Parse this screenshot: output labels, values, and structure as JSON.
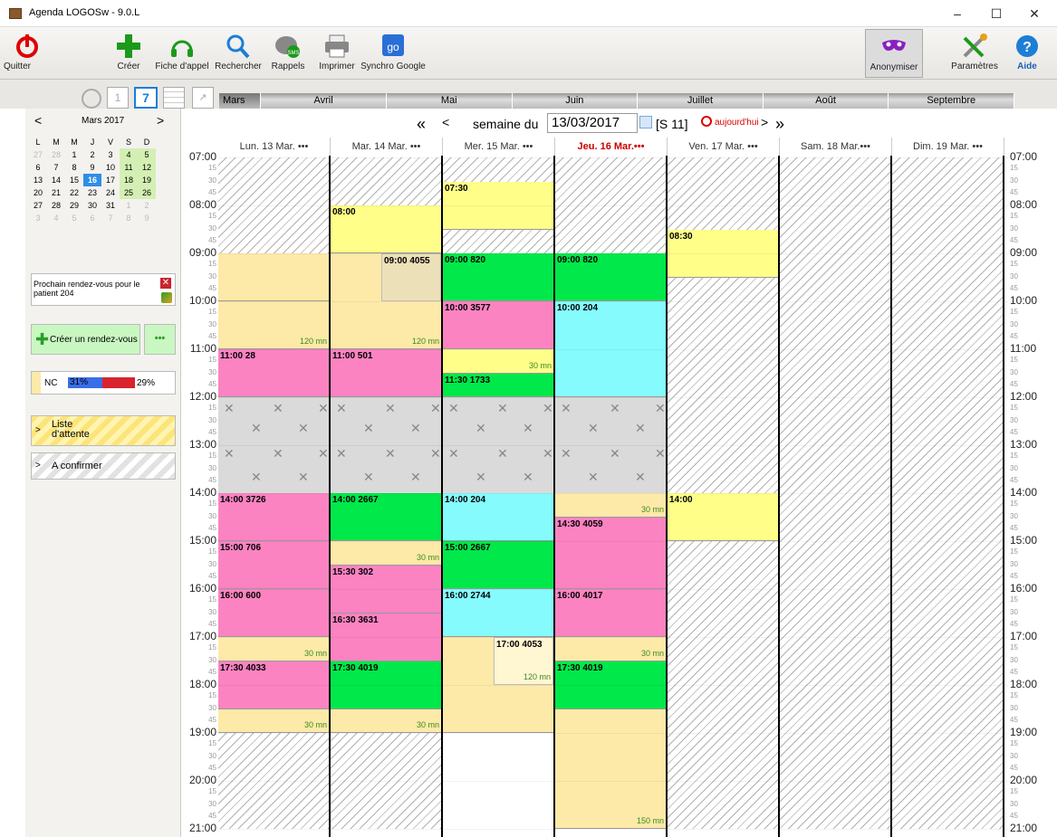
{
  "window": {
    "title": "Agenda LOGOSw - 9.0.L"
  },
  "toolbar": {
    "quit": "Quitter",
    "create": "Créer",
    "callsheet": "Fiche d'appel",
    "search": "Rechercher",
    "reminders": "Rappels",
    "print": "Imprimer",
    "gsync": "Synchro Google",
    "anonymize": "Anonymiser",
    "settings": "Paramètres",
    "help": "Aide",
    "sms_badge": "SMS",
    "calendar_day": "1",
    "calendar_week": "7"
  },
  "months": [
    "Mars",
    "Avril",
    "Mai",
    "Juin",
    "Juillet",
    "Août",
    "Septembre"
  ],
  "mini_calendar": {
    "title": "Mars 2017",
    "prev": "<",
    "next": ">",
    "weekdays": [
      "L",
      "M",
      "M",
      "J",
      "V",
      "S",
      "D"
    ],
    "weeks": [
      [
        "27",
        "28",
        "1",
        "2",
        "3",
        "4",
        "5"
      ],
      [
        "6",
        "7",
        "8",
        "9",
        "10",
        "11",
        "12"
      ],
      [
        "13",
        "14",
        "15",
        "16",
        "17",
        "18",
        "19"
      ],
      [
        "20",
        "21",
        "22",
        "23",
        "24",
        "25",
        "26"
      ],
      [
        "27",
        "28",
        "29",
        "30",
        "31",
        "1",
        "2"
      ],
      [
        "3",
        "4",
        "5",
        "6",
        "7",
        "8",
        "9"
      ]
    ]
  },
  "next_appt": {
    "text": "Prochain rendez-vous pour le patient 204"
  },
  "create_appt": {
    "label": "Créer un rendez-vous",
    "more": "•••"
  },
  "stats": {
    "nc": "NC",
    "pct1": "31%",
    "pct2": "29%"
  },
  "waiting": {
    "label": "Liste d'attente"
  },
  "confirm": {
    "label": "A confirmer"
  },
  "weeknav": {
    "prev2": "«",
    "prev": "<",
    "label": "semaine du",
    "date": "13/03/2017",
    "week": "[S 11]",
    "today": "aujourd'hui",
    "next": ">",
    "next2": "»"
  },
  "days": [
    "Lun. 13 Mar. •••",
    "Mar. 14 Mar. •••",
    "Mer. 15 Mar. •••",
    "Jeu. 16 Mar.•••",
    "Ven. 17 Mar. •••",
    "Sam. 18 Mar.•••",
    "Dim. 19 Mar. •••"
  ],
  "hours": [
    "07:00",
    "08:00",
    "09:00",
    "10:00",
    "11:00",
    "12:00",
    "13:00",
    "14:00",
    "15:00",
    "16:00",
    "17:00",
    "18:00",
    "19:00",
    "20:00",
    "21:00"
  ],
  "quarter_labels": [
    "15",
    "30",
    "45"
  ],
  "appointments": [
    {
      "day": 0,
      "start": "09:00",
      "end": "10:00",
      "label": "",
      "color": "#fde9a8"
    },
    {
      "day": 0,
      "start": "10:00",
      "end": "11:00",
      "label": "",
      "color": "#fde9a8",
      "dur": "120 mn"
    },
    {
      "day": 0,
      "start": "11:00",
      "end": "12:00",
      "label": "11:00  28",
      "color": "#fb83c2"
    },
    {
      "day": 0,
      "start": "14:00",
      "end": "15:00",
      "label": "14:00  3726",
      "color": "#fb83c2"
    },
    {
      "day": 0,
      "start": "15:00",
      "end": "16:00",
      "label": "15:00  706",
      "color": "#fb83c2"
    },
    {
      "day": 0,
      "start": "16:00",
      "end": "17:00",
      "label": "16:00  600",
      "color": "#fb83c2"
    },
    {
      "day": 0,
      "start": "17:00",
      "end": "17:30",
      "label": "",
      "color": "#fde9a8",
      "dur": "30 mn"
    },
    {
      "day": 0,
      "start": "17:30",
      "end": "18:30",
      "label": "17:30  4033",
      "color": "#fb83c2"
    },
    {
      "day": 0,
      "start": "18:30",
      "end": "19:00",
      "label": "",
      "color": "#fde9a8",
      "dur": "30 mn"
    },
    {
      "day": 1,
      "start": "08:00",
      "end": "09:00",
      "label": "08:00",
      "color": "#fefe89"
    },
    {
      "day": 1,
      "start": "09:00",
      "end": "11:00",
      "label": "",
      "color": "#fde9a8",
      "dur": "120 mn"
    },
    {
      "day": 1,
      "start": "11:00",
      "end": "12:00",
      "label": "11:00  501",
      "color": "#fb83c2"
    },
    {
      "day": 1,
      "start": "14:00",
      "end": "15:00",
      "label": "14:00  2667",
      "color": "#00e84a"
    },
    {
      "day": 1,
      "start": "15:00",
      "end": "15:30",
      "label": "",
      "color": "#fde9a8",
      "dur": "30 mn"
    },
    {
      "day": 1,
      "start": "15:30",
      "end": "16:30",
      "label": "15:30  302",
      "color": "#fb83c2"
    },
    {
      "day": 1,
      "start": "16:30",
      "end": "17:30",
      "label": "16:30  3631",
      "color": "#fb83c2"
    },
    {
      "day": 1,
      "start": "17:30",
      "end": "18:30",
      "label": "17:30  4019",
      "color": "#00e84a"
    },
    {
      "day": 1,
      "start": "18:30",
      "end": "19:00",
      "label": "",
      "color": "#fde9a8",
      "dur": "30 mn"
    },
    {
      "day": 2,
      "start": "07:30",
      "end": "08:30",
      "label": "07:30",
      "color": "#fefe89"
    },
    {
      "day": 2,
      "start": "09:00",
      "end": "10:00",
      "label": "09:00  820",
      "color": "#00e84a"
    },
    {
      "day": 2,
      "start": "10:00",
      "end": "11:00",
      "label": "10:00  3577",
      "color": "#fb83c2"
    },
    {
      "day": 2,
      "start": "11:00",
      "end": "11:30",
      "label": "",
      "color": "#fefe89",
      "dur": "30 mn"
    },
    {
      "day": 2,
      "start": "11:30",
      "end": "12:00",
      "label": "11:30  1733",
      "color": "#00e84a"
    },
    {
      "day": 2,
      "start": "14:00",
      "end": "15:00",
      "label": "14:00  204",
      "color": "#85fbfd"
    },
    {
      "day": 2,
      "start": "15:00",
      "end": "16:00",
      "label": "15:00  2667",
      "color": "#00e84a"
    },
    {
      "day": 2,
      "start": "16:00",
      "end": "17:00",
      "label": "16:00  2744",
      "color": "#85fbfd"
    },
    {
      "day": 2,
      "start": "17:00",
      "end": "19:00",
      "label": "",
      "color": "#fde9a8"
    },
    {
      "day": 3,
      "start": "09:00",
      "end": "10:00",
      "label": "09:00  820",
      "color": "#00e84a"
    },
    {
      "day": 3,
      "start": "10:00",
      "end": "12:00",
      "label": "10:00  204",
      "color": "#85fbfd"
    },
    {
      "day": 3,
      "start": "14:00",
      "end": "14:30",
      "label": "",
      "color": "#fde9a8",
      "dur": "30 mn"
    },
    {
      "day": 3,
      "start": "14:30",
      "end": "16:00",
      "label": "14:30  4059",
      "color": "#fb83c2"
    },
    {
      "day": 3,
      "start": "16:00",
      "end": "17:00",
      "label": "16:00  4017",
      "color": "#fb83c2"
    },
    {
      "day": 3,
      "start": "17:00",
      "end": "17:30",
      "label": "",
      "color": "#fde9a8",
      "dur": "30 mn"
    },
    {
      "day": 3,
      "start": "17:30",
      "end": "18:30",
      "label": "17:30  4019",
      "color": "#00e84a"
    },
    {
      "day": 3,
      "start": "18:30",
      "end": "21:00",
      "label": "",
      "color": "#fde9a8",
      "dur": "150 mn"
    },
    {
      "day": 4,
      "start": "08:30",
      "end": "09:30",
      "label": "08:30",
      "color": "#fefe89"
    },
    {
      "day": 4,
      "start": "14:00",
      "end": "15:00",
      "label": "14:00",
      "color": "#fefe89"
    }
  ],
  "overlays": [
    {
      "day": 1,
      "start": "09:00",
      "end": "10:00",
      "label": "09:00  4055",
      "color": "#ece0b8"
    },
    {
      "day": 2,
      "start": "17:00",
      "end": "18:00",
      "label": "17:00  4053",
      "color": "#fff6d2",
      "dur": "120 mn"
    }
  ],
  "hatch": [
    {
      "day": 0,
      "start": "07:00",
      "end": "09:00"
    },
    {
      "day": 0,
      "start": "19:00",
      "end": "21:00"
    },
    {
      "day": 1,
      "start": "07:00",
      "end": "08:00"
    },
    {
      "day": 1,
      "start": "19:00",
      "end": "21:00"
    },
    {
      "day": 2,
      "start": "07:00",
      "end": "07:30"
    },
    {
      "day": 2,
      "start": "08:30",
      "end": "09:00"
    },
    {
      "day": 3,
      "start": "07:00",
      "end": "09:00"
    },
    {
      "day": 4,
      "start": "07:00",
      "end": "08:30"
    },
    {
      "day": 4,
      "start": "09:30",
      "end": "14:00"
    },
    {
      "day": 4,
      "start": "15:00",
      "end": "21:00"
    },
    {
      "day": 5,
      "start": "07:00",
      "end": "21:00"
    },
    {
      "day": 6,
      "start": "07:00",
      "end": "21:00"
    }
  ],
  "lunch": {
    "start": "12:00",
    "end": "14:00",
    "days": [
      0,
      1,
      2,
      3
    ]
  }
}
